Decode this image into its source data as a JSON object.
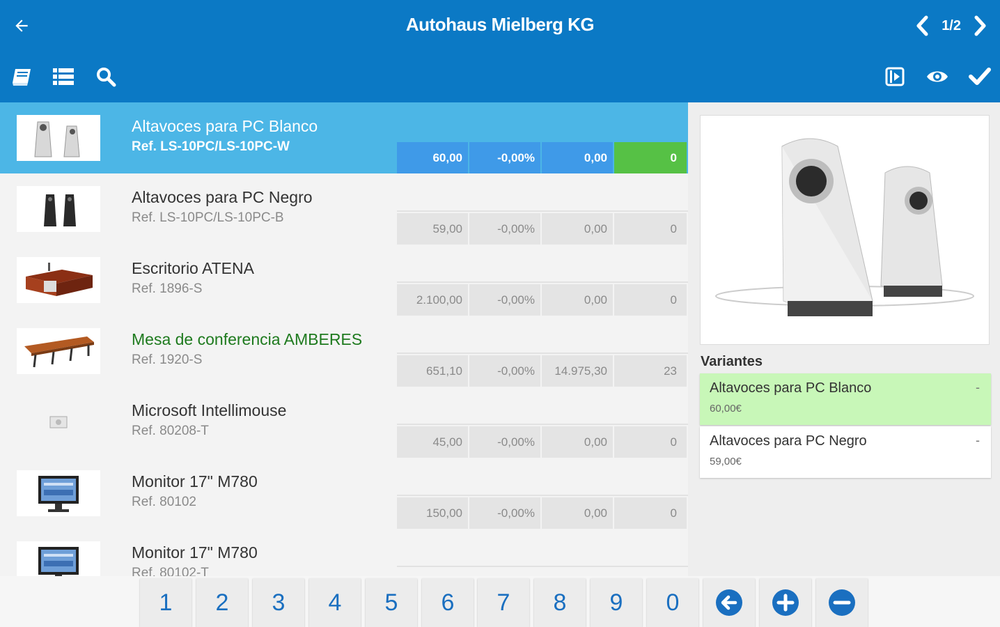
{
  "header": {
    "title": "Autohaus Mielberg KG",
    "page_indicator": "1/2",
    "color": "#0b79c5"
  },
  "toolbar": {
    "left_icons": [
      "book-icon",
      "list-icon",
      "search-icon"
    ],
    "right_icons": [
      "play-icon",
      "eye-icon",
      "check-icon"
    ]
  },
  "products": [
    {
      "name": "Altavoces para PC Blanco",
      "ref": "Ref. LS-10PC/LS-10PC-W",
      "price": "60,00",
      "discount": "-0,00%",
      "total": "0,00",
      "qty": "0"
    },
    {
      "name": "Altavoces para PC Negro",
      "ref": "Ref. LS-10PC/LS-10PC-B",
      "price": "59,00",
      "discount": "-0,00%",
      "total": "0,00",
      "qty": "0"
    },
    {
      "name": "Escritorio ATENA",
      "ref": "Ref. 1896-S",
      "price": "2.100,00",
      "discount": "-0,00%",
      "total": "0,00",
      "qty": "0"
    },
    {
      "name": "Mesa de conferencia AMBERES",
      "ref": "Ref. 1920-S",
      "price": "651,10",
      "discount": "-0,00%",
      "total": "14.975,30",
      "qty": "23"
    },
    {
      "name": "Microsoft Intellimouse",
      "ref": "Ref. 80208-T",
      "price": "45,00",
      "discount": "-0,00%",
      "total": "0,00",
      "qty": "0"
    },
    {
      "name": "Monitor 17\" M780",
      "ref": "Ref. 80102",
      "price": "150,00",
      "discount": "-0,00%",
      "total": "0,00",
      "qty": "0"
    },
    {
      "name": "Monitor 17\" M780",
      "ref": "Ref. 80102-T",
      "price": "",
      "discount": "",
      "total": "",
      "qty": ""
    }
  ],
  "detail": {
    "variants_title": "Variantes",
    "variants": [
      {
        "name": "Altavoces para PC Blanco",
        "price": "60,00€",
        "marker": "-"
      },
      {
        "name": "Altavoces para PC Negro",
        "price": "59,00€",
        "marker": "-"
      }
    ]
  },
  "keypad": {
    "digits": [
      "1",
      "2",
      "3",
      "4",
      "5",
      "6",
      "7",
      "8",
      "9",
      "0"
    ],
    "actions": [
      "backspace-icon",
      "plus-icon",
      "minus-icon"
    ]
  }
}
